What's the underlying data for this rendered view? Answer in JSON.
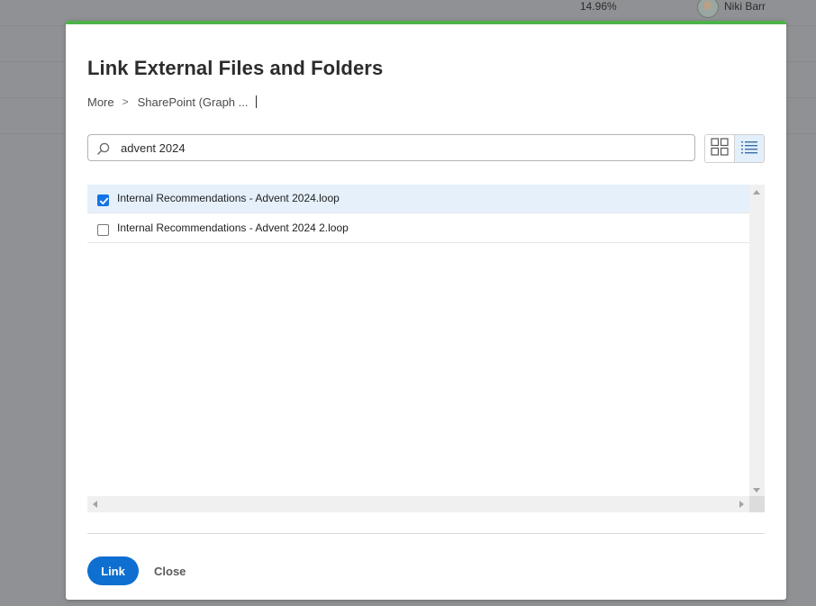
{
  "background": {
    "percentage": "14.96%",
    "user_name": "Niki Barr"
  },
  "dialog": {
    "title": "Link External Files and Folders",
    "breadcrumb": {
      "items": [
        "More",
        "SharePoint (Graph ..."
      ],
      "separator": ">"
    },
    "search": {
      "value": "advent 2024",
      "icon": "search-icon"
    },
    "view_toggle": {
      "options": [
        "grid-view-icon",
        "list-view-icon"
      ],
      "selected": "list"
    },
    "files": [
      {
        "name": "Internal Recommendations - Advent 2024.loop",
        "checked": true
      },
      {
        "name": "Internal Recommendations - Advent 2024 2.loop",
        "checked": false
      }
    ],
    "buttons": {
      "link": "Link",
      "close": "Close"
    }
  },
  "colors": {
    "accent_bar": "#4cb24a",
    "primary_button": "#0f6fd1",
    "selected_row": "#e5f0fb",
    "checkbox_checked": "#1473e6",
    "overlay": "#8f9194"
  }
}
